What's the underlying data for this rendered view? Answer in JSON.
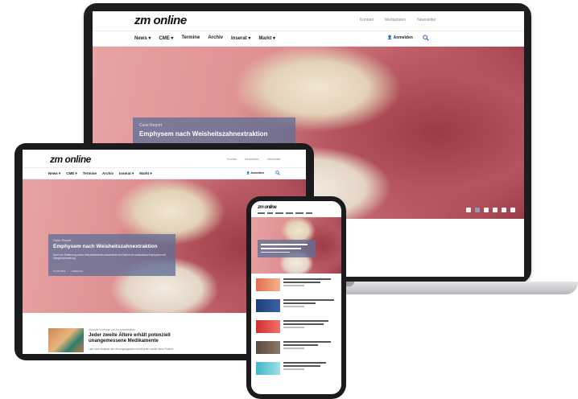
{
  "brand": {
    "logo": "zm online"
  },
  "top_links": [
    "Kontakt",
    "Mediadaten",
    "Newsletter"
  ],
  "nav": [
    "News",
    "CME",
    "Termine",
    "Archiv",
    "Inserat",
    "Markt"
  ],
  "nav_dropdown": [
    true,
    true,
    false,
    false,
    true,
    true
  ],
  "login_label": "Anmelden",
  "hero": {
    "kicker": "Case Report",
    "headline": "Emphysem nach Weisheitszahnextraktion",
    "teaser": "Nach der Entfernung eines Weisheitszahnes entwickelte ein Patient ein subkutanes Emphysem mit Wangenschwellung.",
    "date": "01.08.2023",
    "author": "Fallbericht"
  },
  "carousel": {
    "total": 6,
    "active": 1
  },
  "article": {
    "kicker": "Aktuelle Umfrage zur Arzneimittelliste",
    "title_line1": "Jeder zweite Ältere erhält potenziell",
    "title_line2": "unangemessene Medikamente",
    "teaser": "Laut einer Analyse der Versorgungsdaten erhält jeder zweite ältere Patient..."
  },
  "phone_thumb_colors": [
    "#e0704f",
    "#1f3d78",
    "#d32f2f",
    "#5b4a3e",
    "#3fb7c8"
  ],
  "colors": {
    "caption_bg": "#607096",
    "accent": "#8e9ab8",
    "device_frame": "#1b1b1d"
  },
  "icons": {
    "user": "user-icon",
    "search": "search-icon",
    "chevron": "chevron-down-icon"
  }
}
